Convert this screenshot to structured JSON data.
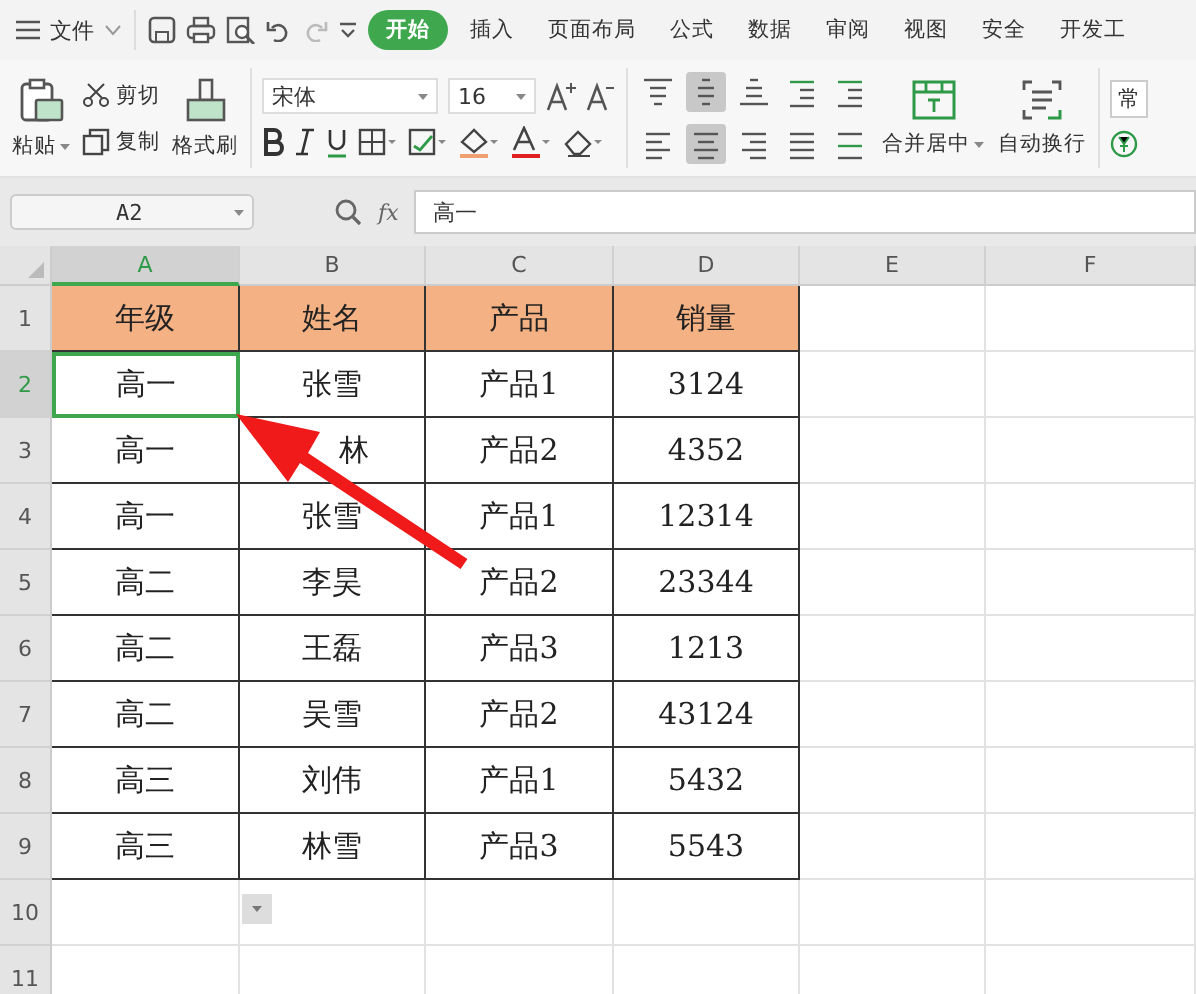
{
  "menu": {
    "file_label": "文件",
    "tabs": [
      {
        "label": "开始",
        "selected": true
      },
      {
        "label": "插入",
        "selected": false
      },
      {
        "label": "页面布局",
        "selected": false
      },
      {
        "label": "公式",
        "selected": false
      },
      {
        "label": "数据",
        "selected": false
      },
      {
        "label": "审阅",
        "selected": false
      },
      {
        "label": "视图",
        "selected": false
      },
      {
        "label": "安全",
        "selected": false
      },
      {
        "label": "开发工",
        "selected": false
      }
    ]
  },
  "clipboard": {
    "paste": "粘贴",
    "cut": "剪切",
    "copy": "复制",
    "painter": "格式刷"
  },
  "font": {
    "family": "宋体",
    "size": "16"
  },
  "align_buttons": [
    {
      "kind": "top",
      "selected": false
    },
    {
      "kind": "middle",
      "selected": true
    },
    {
      "kind": "bottom",
      "selected": false
    },
    {
      "kind": "outdent",
      "selected": false
    },
    {
      "kind": "indent",
      "selected": false
    },
    {
      "kind": "left",
      "selected": false
    },
    {
      "kind": "center",
      "selected": true
    },
    {
      "kind": "right",
      "selected": false
    },
    {
      "kind": "justify",
      "selected": false
    },
    {
      "kind": "distribute",
      "selected": false
    }
  ],
  "merge_label": "合并居中",
  "wrap_label": "自动换行",
  "number_format": "常",
  "formula_bar": {
    "name_box": "A2",
    "function_label": "fx",
    "value": "高一"
  },
  "columns": [
    {
      "label": "A",
      "selected": true
    },
    {
      "label": "B",
      "selected": false
    },
    {
      "label": "C",
      "selected": false
    },
    {
      "label": "D",
      "selected": false
    },
    {
      "label": "E",
      "selected": false
    },
    {
      "label": "F",
      "selected": false
    }
  ],
  "rows": [
    {
      "number": "1",
      "selected": false,
      "cells": [
        "年级",
        "姓名",
        "产品",
        "销量"
      ]
    },
    {
      "number": "2",
      "selected": true,
      "cells": [
        "高一",
        "张雪",
        "产品1",
        "3124"
      ]
    },
    {
      "number": "3",
      "selected": false,
      "cells": [
        "高一",
        "林",
        "产品2",
        "4352"
      ]
    },
    {
      "number": "4",
      "selected": false,
      "cells": [
        "高一",
        "张雪",
        "产品1",
        "12314"
      ]
    },
    {
      "number": "5",
      "selected": false,
      "cells": [
        "高二",
        "李昊",
        "产品2",
        "23344"
      ]
    },
    {
      "number": "6",
      "selected": false,
      "cells": [
        "高二",
        "王磊",
        "产品3",
        "1213"
      ]
    },
    {
      "number": "7",
      "selected": false,
      "cells": [
        "高二",
        "吴雪",
        "产品2",
        "43124"
      ]
    },
    {
      "number": "8",
      "selected": false,
      "cells": [
        "高三",
        "刘伟",
        "产品1",
        "5432"
      ]
    },
    {
      "number": "9",
      "selected": false,
      "cells": [
        "高三",
        "林雪",
        "产品3",
        "5543"
      ]
    },
    {
      "number": "10",
      "selected": false,
      "cells": []
    },
    {
      "number": "11",
      "selected": false,
      "cells": []
    }
  ]
}
